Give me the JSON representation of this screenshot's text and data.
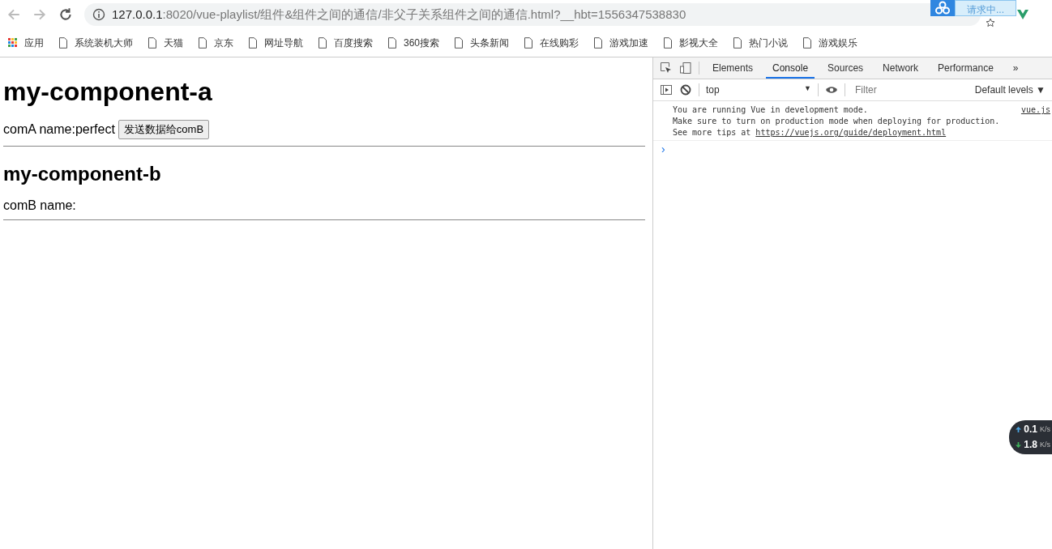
{
  "address_bar": {
    "host": "127.0.0.1",
    "path": ":8020/vue-playlist/组件&组件之间的通信/非父子关系组件之间的通信.html?__hbt=1556347538830"
  },
  "extension_popup": {
    "label": "请求中..."
  },
  "bookmarks": [
    "应用",
    "系统装机大师",
    "天猫",
    "京东",
    "网址导航",
    "百度搜索",
    "360搜索",
    "头条新闻",
    "在线购彩",
    "游戏加速",
    "影视大全",
    "热门小说",
    "游戏娱乐"
  ],
  "page": {
    "heading_a": "my-component-a",
    "line_a": "comA name:perfect",
    "button": "发送数据给comB",
    "heading_b": "my-component-b",
    "line_b": "comB name:"
  },
  "devtools": {
    "tabs": [
      {
        "label": "Elements",
        "selected": false
      },
      {
        "label": "Console",
        "selected": true
      },
      {
        "label": "Sources",
        "selected": false
      },
      {
        "label": "Network",
        "selected": false
      },
      {
        "label": "Performance",
        "selected": false
      }
    ],
    "more_tabs": "»",
    "context": "top",
    "context_arrow": "▼",
    "filter": {
      "placeholder": "Filter"
    },
    "levels": "Default levels ▼",
    "messages": [
      {
        "text": "You are running Vue in development mode.",
        "source": "vue.js"
      },
      {
        "text": "Make sure to turn on production mode when deploying for production."
      },
      {
        "text": "See more tips at ",
        "link": "https://vuejs.org/guide/deployment.html"
      }
    ],
    "prompt": "›"
  },
  "speed_widget": [
    {
      "value": "0.1",
      "unit": "K/s",
      "kind": "up"
    },
    {
      "value": "1.8",
      "unit": "K/s",
      "kind": "down"
    }
  ]
}
